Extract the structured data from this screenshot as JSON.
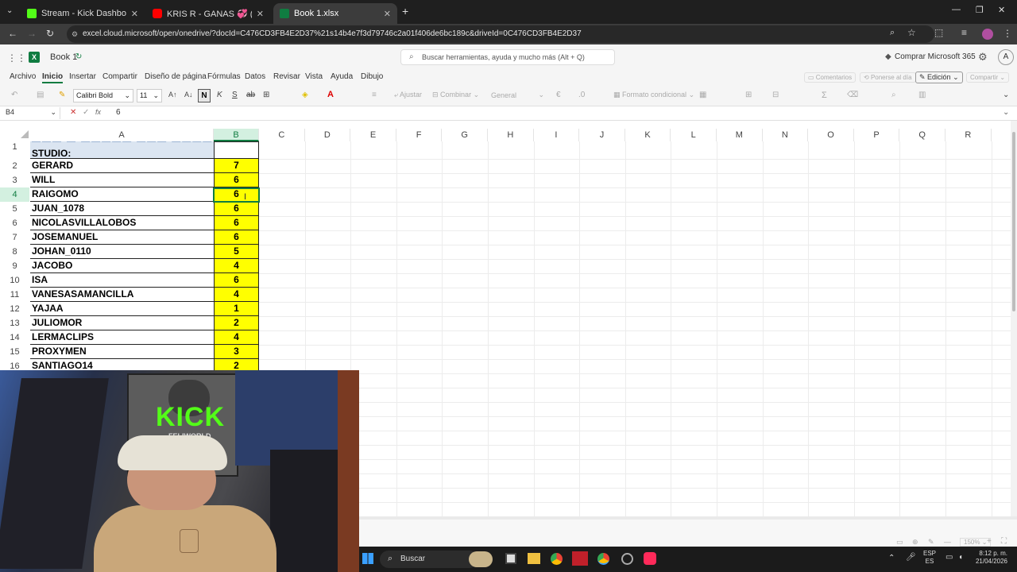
{
  "browser": {
    "tabs": [
      {
        "label": "Stream - Kick Dashboard",
        "color": "#53fc18",
        "active": false
      },
      {
        "label": "KRIS R - GANAS 💞 (VIDEO OF",
        "color": "#ff0000",
        "active": false
      },
      {
        "label": "Book 1.xlsx",
        "color": "#107c41",
        "active": true
      }
    ],
    "url": "excel.cloud.microsoft/open/onedrive/?docId=C476CD3FB4E2D37%21s14b4e7f3d79746c2a01f406de6bc189c&driveId=0C476CD3FB4E2D37"
  },
  "excel": {
    "book_title": "Book 1",
    "search_placeholder": "Buscar herramientas, ayuda y mucho más (Alt + Q)",
    "buy_label": "Comprar Microsoft 365",
    "avatar_letter": "A",
    "ribbon_tabs": [
      "Archivo",
      "Inicio",
      "Insertar",
      "Compartir",
      "Diseño de página",
      "Fórmulas",
      "Datos",
      "Revisar",
      "Vista",
      "Ayuda",
      "Dibujo"
    ],
    "ribbon_right": {
      "comments": "Comentarios",
      "catchup": "Ponerse al día",
      "editing": "Edición",
      "share": "Compartir"
    },
    "toolbar": {
      "font": "Calibri Bold",
      "size": "11",
      "bold": "N",
      "wrap": "Ajustar",
      "merge": "Combinar",
      "number_format": "General",
      "conditional": "Formato condicional"
    },
    "name_box": "B4",
    "formula_value": "6",
    "columns": [
      "A",
      "B",
      "C",
      "D",
      "E",
      "F",
      "G",
      "H",
      "I",
      "J",
      "K",
      "L",
      "M",
      "N",
      "O",
      "P",
      "Q",
      "R"
    ],
    "row1_label": "STUDIO:",
    "rows": [
      {
        "num": "2",
        "name": "GERARD",
        "value": "7"
      },
      {
        "num": "3",
        "name": "WILL",
        "value": "6"
      },
      {
        "num": "4",
        "name": "RAIGOMO",
        "value": "6"
      },
      {
        "num": "5",
        "name": "JUAN_1078",
        "value": "6"
      },
      {
        "num": "6",
        "name": "NICOLASVILLALOBOS",
        "value": "6"
      },
      {
        "num": "7",
        "name": "JOSEMANUEL",
        "value": "6"
      },
      {
        "num": "8",
        "name": "JOHAN_0110",
        "value": "5"
      },
      {
        "num": "9",
        "name": "JACOBO",
        "value": "4"
      },
      {
        "num": "10",
        "name": "ISA",
        "value": "6"
      },
      {
        "num": "11",
        "name": "VANESASAMANCILLA",
        "value": "4"
      },
      {
        "num": "12",
        "name": "YAJAA",
        "value": "1"
      },
      {
        "num": "13",
        "name": "JULIOMOR",
        "value": "2"
      },
      {
        "num": "14",
        "name": "LERMACLIPS",
        "value": "4"
      },
      {
        "num": "15",
        "name": "PROXYMEN",
        "value": "3"
      },
      {
        "num": "16",
        "name": "SANTIAGO14",
        "value": "2"
      }
    ],
    "zoom": "150%"
  },
  "webcam": {
    "sign": "KICK",
    "sign_sub": "FELIWORLD"
  },
  "taskbar": {
    "search": "Buscar",
    "lang_top": "ESP",
    "lang_bottom": "ES",
    "time": "8:12 p. m.",
    "date": "21/04/2026"
  }
}
